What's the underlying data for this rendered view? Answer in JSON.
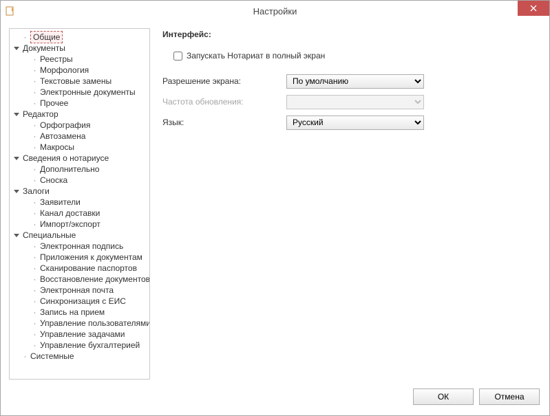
{
  "window": {
    "title": "Настройки",
    "close_icon": "close"
  },
  "tree": {
    "general": "Общие",
    "documents": {
      "label": "Документы",
      "items": [
        "Реестры",
        "Морфология",
        "Текстовые замены",
        "Электронные документы",
        "Прочее"
      ]
    },
    "editor": {
      "label": "Редактор",
      "items": [
        "Орфография",
        "Автозамена",
        "Макросы"
      ]
    },
    "notary": {
      "label": "Сведения о нотариусе",
      "items": [
        "Дополнительно",
        "Сноска"
      ]
    },
    "pledge": {
      "label": "Залоги",
      "items": [
        "Заявители",
        "Канал доставки",
        "Импорт/экспорт"
      ]
    },
    "special": {
      "label": "Специальные",
      "items": [
        "Электронная подпись",
        "Приложения к документам",
        "Сканирование паспортов",
        "Восстановление документов",
        "Электронная почта",
        "Синхронизация с ЕИС",
        "Запись на прием",
        "Управление пользователями",
        "Управление задачами",
        "Управление бухгалтерией"
      ]
    },
    "system": "Системные"
  },
  "panel": {
    "heading": "Интерфейс:",
    "fullscreen_label": "Запускать Нотариат в полный экран",
    "fullscreen_checked": false,
    "resolution_label": "Разрешение экрана:",
    "resolution_value": "По умолчанию",
    "refresh_label": "Частота обновления:",
    "refresh_value": "",
    "language_label": "Язык:",
    "language_value": "Русский"
  },
  "buttons": {
    "ok": "ОК",
    "cancel": "Отмена"
  }
}
